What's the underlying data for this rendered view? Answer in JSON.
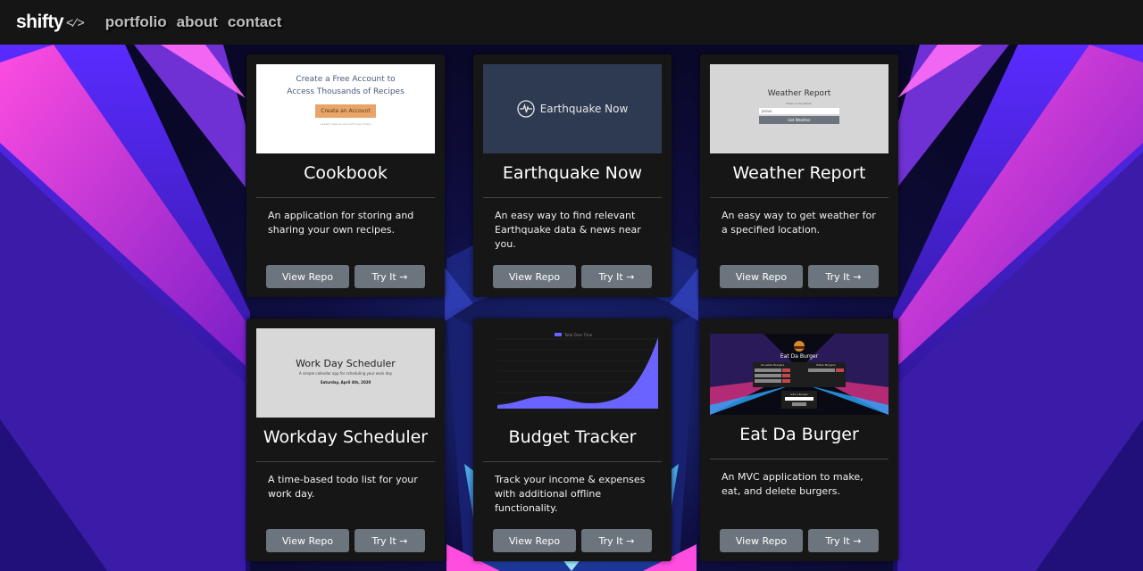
{
  "nav": {
    "logo_text": "shifty",
    "logo_icon": "code-brackets-icon",
    "links": [
      "portfolio",
      "about",
      "contact"
    ]
  },
  "cards": [
    {
      "title": "Cookbook",
      "description": "An application for storing and sharing your own recipes.",
      "repo_label": "View Repo",
      "try_label": "Try It →",
      "thumb": {
        "heading_line1": "Create a Free Account to",
        "heading_line2": "Access Thousands of Recipes",
        "button": "Create an Account",
        "small": "Already have an account? Log in here"
      }
    },
    {
      "title": "Earthquake Now",
      "description": "An easy way to find relevant Earthquake data & news near you.",
      "repo_label": "View Repo",
      "try_label": "Try It →",
      "thumb": {
        "heading": "Earthquake Now",
        "icon": "heartbeat-icon"
      }
    },
    {
      "title": "Weather Report",
      "description": "An easy way to get weather for a specified location.",
      "repo_label": "View Repo",
      "try_label": "Try It →",
      "thumb": {
        "heading": "Weather Report",
        "label": "Enter A City Name:",
        "input_value": "provo",
        "button": "Get Weather"
      }
    },
    {
      "title": "Workday Scheduler",
      "description": "A time-based todo list for your work day.",
      "repo_label": "View Repo",
      "try_label": "Try It →",
      "thumb": {
        "heading": "Work Day Scheduler",
        "subtitle": "A simple calendar app for scheduling your work day",
        "date": "Saturday, April 4th, 2020"
      }
    },
    {
      "title": "Budget Tracker",
      "description": "Track your income & expenses with additional offline functionality.",
      "repo_label": "View Repo",
      "try_label": "Try It →",
      "thumb": {
        "legend": "Total Over Time",
        "fill_color": "#6a63ff"
      }
    },
    {
      "title": "Eat Da Burger",
      "description": "An MVC application to make, eat, and delete burgers.",
      "repo_label": "View Repo",
      "try_label": "Try It →",
      "thumb": {
        "heading": "Eat Da Burger",
        "col1": "Un-eaten Burgers",
        "col2": "Eaten Burgers",
        "add_label": "Add a Burger",
        "icon": "burger-icon"
      }
    }
  ],
  "colors": {
    "navbar": "#151515",
    "card": "#161616",
    "button": "#6c757d",
    "accent_magenta": "#c43bd8",
    "accent_purple": "#6a38ff",
    "accent_cyan": "#3fb4ff"
  }
}
